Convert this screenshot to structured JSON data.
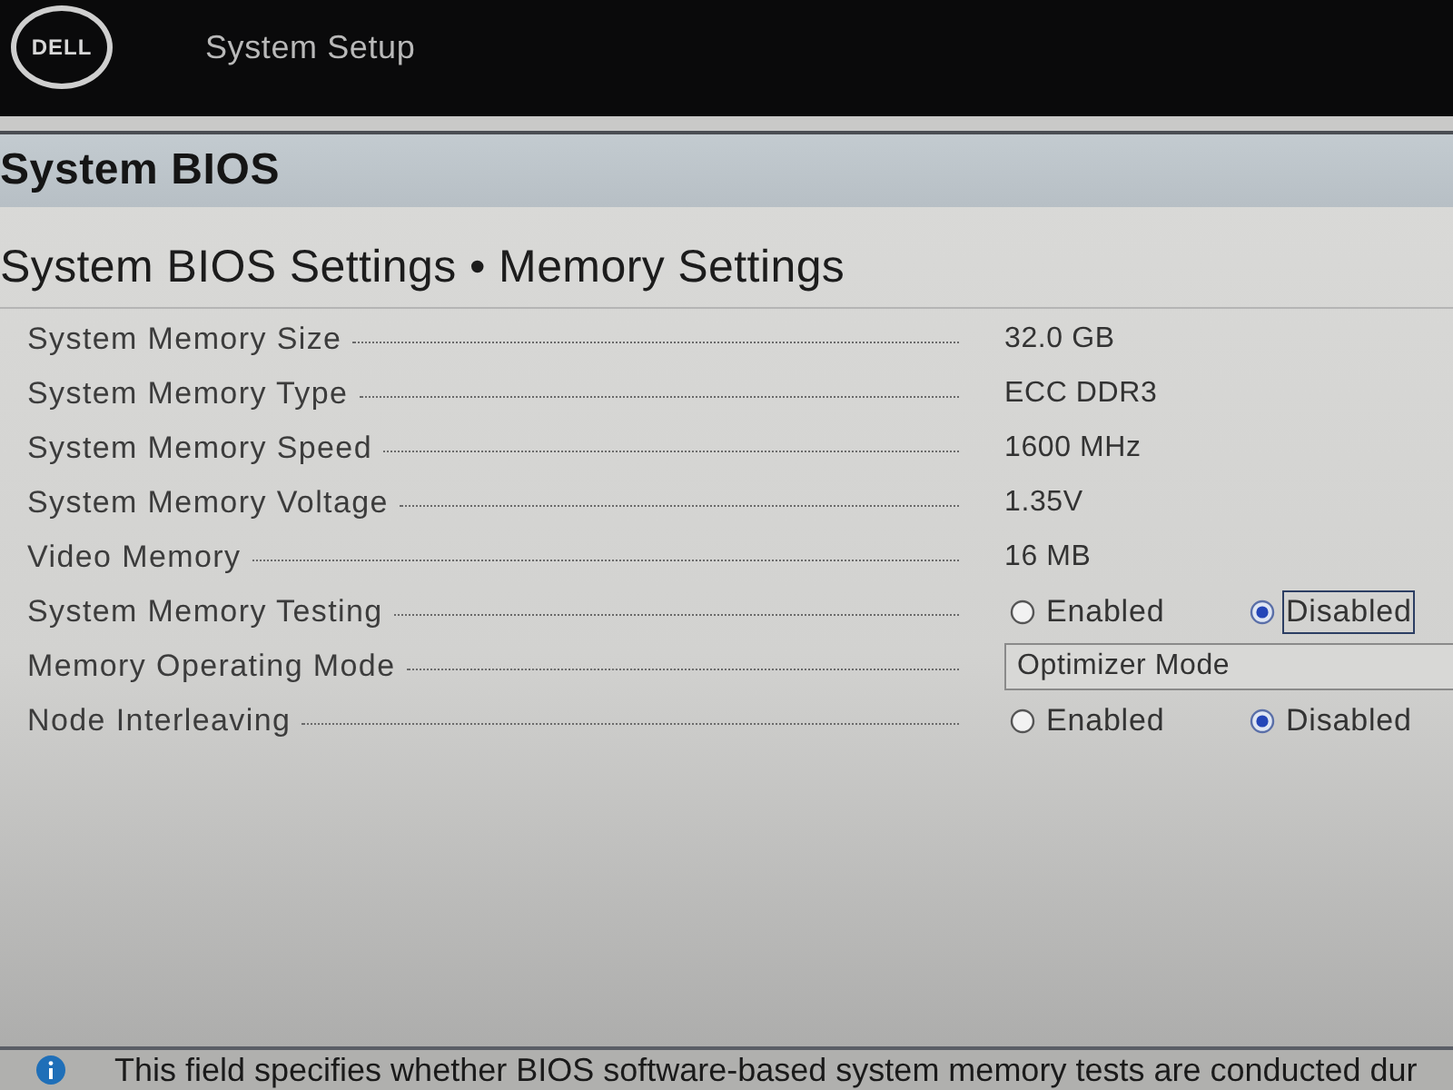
{
  "header": {
    "logo": "DELL",
    "title": "System Setup"
  },
  "page_title": "System BIOS",
  "breadcrumb": "System BIOS Settings • Memory Settings",
  "settings": [
    {
      "kind": "value",
      "label": "System Memory Size",
      "value": "32.0 GB"
    },
    {
      "kind": "value",
      "label": "System Memory Type",
      "value": "ECC DDR3"
    },
    {
      "kind": "value",
      "label": "System Memory Speed",
      "value": "1600 MHz"
    },
    {
      "kind": "value",
      "label": "System Memory Voltage",
      "value": "1.35V"
    },
    {
      "kind": "value",
      "label": "Video Memory",
      "value": "16 MB"
    },
    {
      "kind": "radio",
      "label": "System Memory Testing",
      "options": [
        {
          "label": "Enabled",
          "selected": false,
          "focused": false
        },
        {
          "label": "Disabled",
          "selected": true,
          "focused": true
        }
      ]
    },
    {
      "kind": "dropdown",
      "label": "Memory Operating Mode",
      "value": "Optimizer Mode"
    },
    {
      "kind": "radio",
      "label": "Node Interleaving",
      "options": [
        {
          "label": "Enabled",
          "selected": false,
          "focused": false
        },
        {
          "label": "Disabled",
          "selected": true,
          "focused": false
        }
      ]
    }
  ],
  "help_text": "This field specifies whether BIOS software-based system memory tests are conducted dur"
}
